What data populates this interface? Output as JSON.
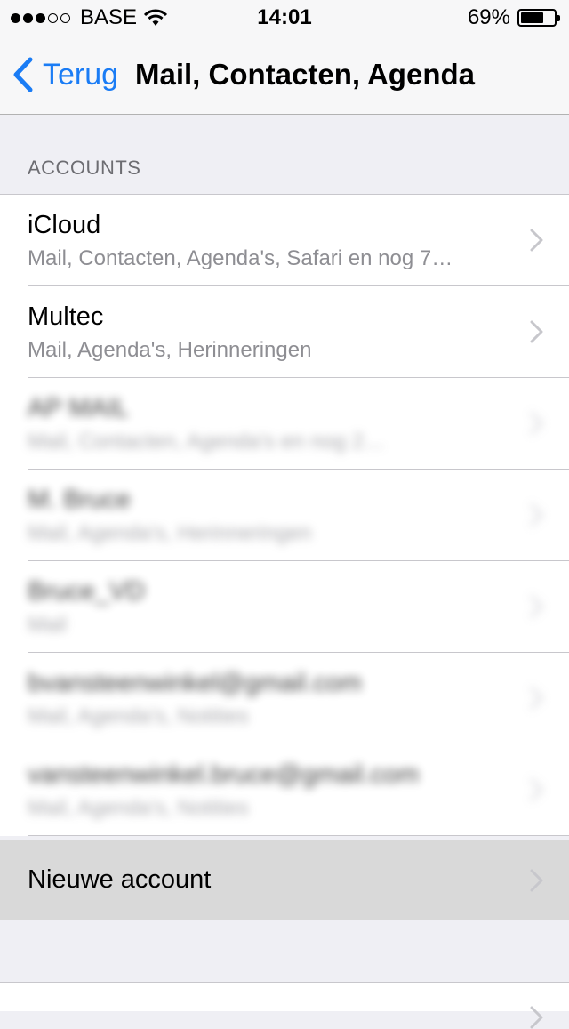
{
  "status_bar": {
    "signal_dots_filled": 3,
    "signal_dots_total": 5,
    "carrier": "BASE",
    "time": "14:01",
    "battery_percent": "69%",
    "battery_level": 0.69
  },
  "nav": {
    "back_label": "Terug",
    "title": "Mail, Contacten, Agenda"
  },
  "accounts": {
    "header": "ACCOUNTS",
    "items": [
      {
        "title": "iCloud",
        "subtitle": "Mail, Contacten, Agenda's, Safari en nog 7…",
        "blurred": false
      },
      {
        "title": "Multec",
        "subtitle": "Mail, Agenda's, Herinneringen",
        "blurred": false
      },
      {
        "title": "AP MAIL",
        "subtitle": "Mail, Contacten, Agenda's en nog 2…",
        "blurred": true
      },
      {
        "title": "M. Bruce",
        "subtitle": "Mail, Agenda's, Herinneringen",
        "blurred": true
      },
      {
        "title": "Bruce_VD",
        "subtitle": "Mail",
        "blurred": true
      },
      {
        "title": "bvansteenwinkel@gmail.com",
        "subtitle": "Mail, Agenda's, Notities",
        "blurred": true
      },
      {
        "title": "vansteenwinkel.bruce@gmail.com",
        "subtitle": "Mail, Agenda's, Notities",
        "blurred": true
      }
    ],
    "new_account_label": "Nieuwe account"
  },
  "colors": {
    "accent": "#1a7cf5",
    "background": "#efeff4",
    "highlight": "#d9d9d9"
  }
}
